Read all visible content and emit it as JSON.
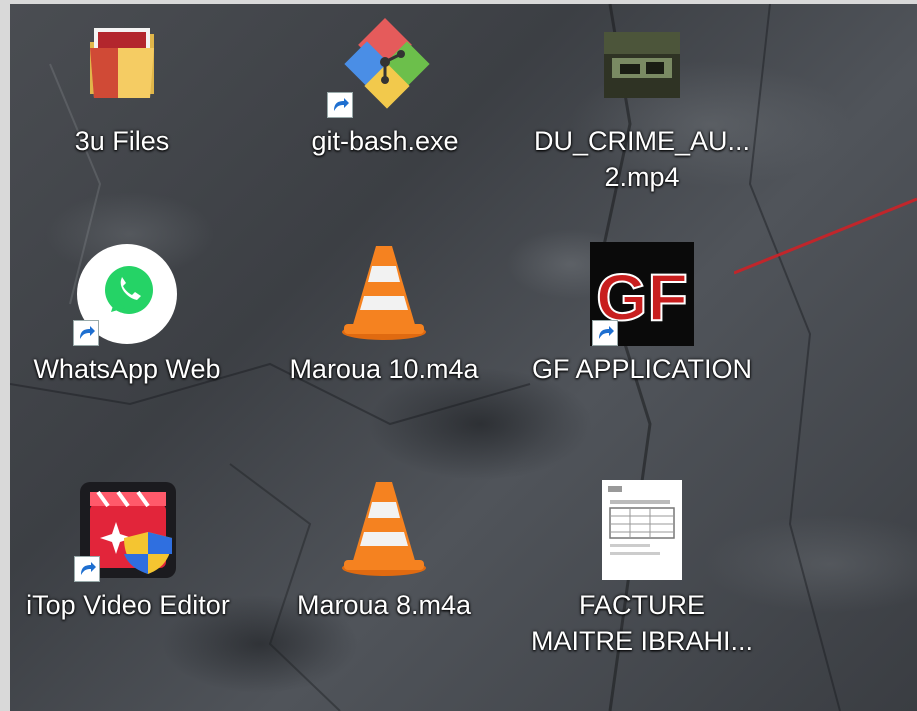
{
  "desktop": {
    "icons": [
      {
        "label": "3u Files",
        "icon": "folder-icon"
      },
      {
        "label": "git-bash.exe",
        "icon": "git-bash-icon"
      },
      {
        "label": "DU_CRIME_AU...",
        "label2": "2.mp4",
        "icon": "video-thumbnail-icon"
      },
      {
        "label": "WhatsApp Web",
        "icon": "whatsapp-icon"
      },
      {
        "label": "Maroua 10.m4a",
        "icon": "vlc-cone-icon"
      },
      {
        "label": "GF APPLICATION",
        "icon": "gf-app-icon",
        "icon_text": "GF"
      },
      {
        "label": "iTop Video Editor",
        "icon": "itop-video-editor-icon"
      },
      {
        "label": "Maroua 8.m4a",
        "icon": "vlc-cone-icon"
      },
      {
        "label": "FACTURE",
        "label2": "MAITRE IBRAHI...",
        "icon": "document-thumbnail-icon"
      }
    ]
  },
  "colors": {
    "annotation_line": "#c0262b",
    "vlc_orange": "#f58220",
    "whatsapp_green": "#25d366",
    "gf_red": "#c81e1e"
  }
}
